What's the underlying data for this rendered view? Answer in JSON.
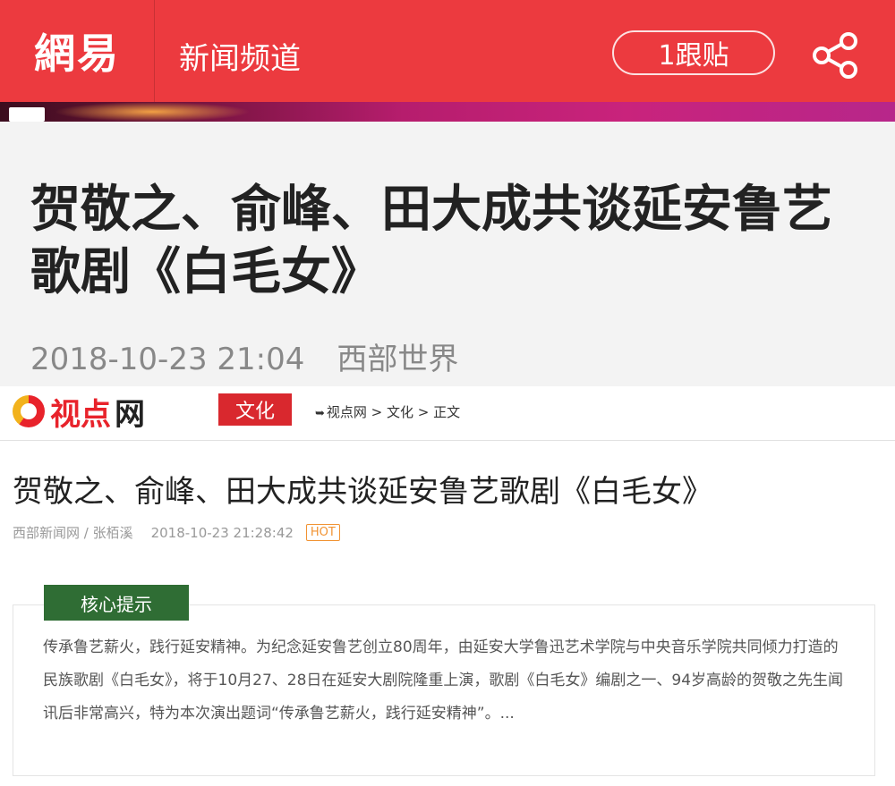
{
  "header": {
    "logo_text": "網易",
    "channel": "新闻频道",
    "follow_label": "1跟贴",
    "share_icon": "share-icon",
    "bg_color": "#ec3a3f"
  },
  "article": {
    "title": "贺敬之、俞峰、田大成共谈延安鲁艺歌剧《白毛女》",
    "datetime": "2018-10-23 21:04",
    "source": "西部世界"
  },
  "embedded": {
    "site_logo_red": "视点",
    "site_logo_black": "网",
    "category": "文化",
    "breadcrumb": "视点网 > 文化 > 正文",
    "title": "贺敬之、俞峰、田大成共谈延安鲁艺歌剧《白毛女》",
    "source_author": "西部新闻网 / 张栢溪",
    "datetime": "2018-10-23 21:28:42",
    "hot_badge": "HOT",
    "summary_label": "核心提示",
    "summary_text": "传承鲁艺薪火，践行延安精神。为纪念延安鲁艺创立80周年，由延安大学鲁迅艺术学院与中央音乐学院共同倾力打造的民族歌剧《白毛女》，将于10月27、28日在延安大剧院隆重上演，歌剧《白毛女》编剧之一、94岁高龄的贺敬之先生闻讯后非常高兴，特为本次演出题词“传承鲁艺薪火，践行延安精神”。..."
  }
}
